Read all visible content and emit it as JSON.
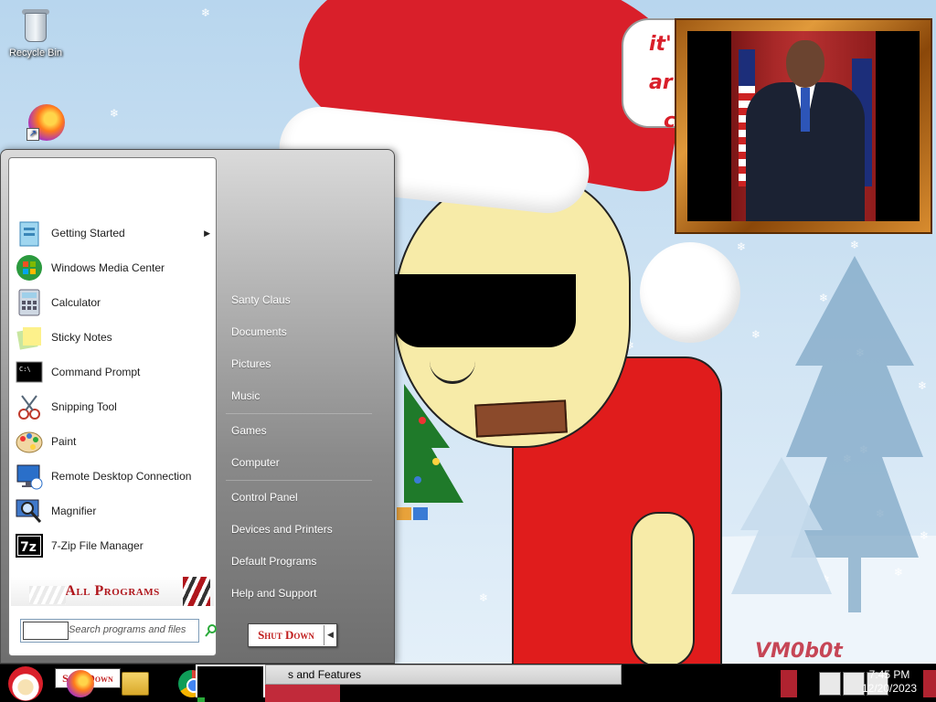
{
  "desktop": {
    "icons": [
      {
        "label": "Recycle Bin",
        "icon": "recycle-bin-icon"
      },
      {
        "label": "",
        "icon": "firefox-shortcut-icon"
      }
    ],
    "wallpaper": {
      "speech_bubble": [
        "it'",
        "ar",
        "c"
      ],
      "watermark": "VM0b0t"
    }
  },
  "start_menu": {
    "programs": [
      {
        "label": "Getting Started",
        "icon": "getting-started-icon",
        "has_submenu": true
      },
      {
        "label": "Windows Media Center",
        "icon": "media-center-icon",
        "has_submenu": false
      },
      {
        "label": "Calculator",
        "icon": "calculator-icon",
        "has_submenu": false
      },
      {
        "label": "Sticky Notes",
        "icon": "sticky-notes-icon",
        "has_submenu": false
      },
      {
        "label": "Command Prompt",
        "icon": "command-prompt-icon",
        "has_submenu": false
      },
      {
        "label": "Snipping Tool",
        "icon": "snipping-tool-icon",
        "has_submenu": false
      },
      {
        "label": "Paint",
        "icon": "paint-icon",
        "has_submenu": false
      },
      {
        "label": "Remote Desktop Connection",
        "icon": "remote-desktop-icon",
        "has_submenu": false
      },
      {
        "label": "Magnifier",
        "icon": "magnifier-icon",
        "has_submenu": false
      },
      {
        "label": "7-Zip File Manager",
        "icon": "seven-zip-icon",
        "has_submenu": false
      }
    ],
    "all_programs": "All Programs",
    "search_placeholder": "Search programs and files",
    "right_links": [
      "Santy Claus",
      "Documents",
      "Pictures",
      "Music",
      "Games",
      "Computer",
      "Control Panel",
      "Devices and Printers",
      "Default Programs",
      "Help and Support"
    ],
    "shutdown_label": "Shut Down"
  },
  "taskbar": {
    "start_button_icon": "santa-orb-icon",
    "pinned": [
      {
        "icon": "firefox-icon"
      },
      {
        "icon": "file-explorer-icon"
      },
      {
        "icon": "chrome-icon"
      }
    ],
    "shutdown_ghost": "Shut Down",
    "tooltip": "s and Features",
    "tray_icons": [
      "action-center-flag-icon",
      "network-icon",
      "volume-icon"
    ],
    "clock": {
      "time": "7:45 PM",
      "date": "12/20/2023"
    }
  },
  "colors": {
    "accent_red": "#c01c1c",
    "taskbar": "#000000",
    "sky": "#b8d6ee"
  }
}
